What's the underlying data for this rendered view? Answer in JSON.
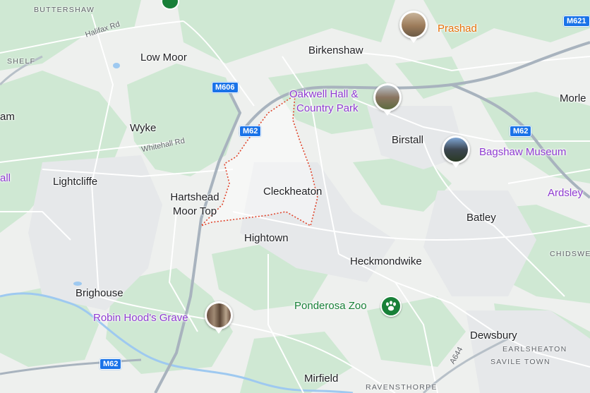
{
  "places": {
    "buttershaw": "BUTTERSHAW",
    "low_moor": "Low Moor",
    "shelf": "SHELF",
    "wyke": "Wyke",
    "lightcliffe": "Lightcliffe",
    "hartshead": "Hartshead Moor Top",
    "cleckheaton": "Cleckheaton",
    "hightown": "Hightown",
    "brighouse": "Brighouse",
    "birkenshaw": "Birkenshaw",
    "birstall": "Birstall",
    "batley": "Batley",
    "heckmondwike": "Heckmondwike",
    "dewsbury": "Dewsbury",
    "mirfield": "Mirfield",
    "morley": "Morle",
    "chidswell": "CHIDSWEL",
    "earlsheaton": "EARLSHEATON",
    "savile_town": "SAVILE TOWN",
    "ravensthorpe": "RAVENSTHORPE",
    "left_edge_m": "am",
    "left_edge_all": "all"
  },
  "pois": {
    "prashad": "Prashad",
    "oakwell_line1": "Oakwell Hall &",
    "oakwell_line2": "Country Park",
    "bagshaw": "Bagshaw Museum",
    "ardsley": "Ardsley",
    "ponderosa": "Ponderosa Zoo",
    "robin_hood": "Robin Hood's Grave"
  },
  "roads": {
    "halifax_rd": "Halifax Rd",
    "whitehall_rd": "Whitehall Rd",
    "a644": "A644",
    "shield_m606": "M606",
    "shield_m62_a": "M62",
    "shield_m62_b": "M62",
    "shield_m62_c": "M62",
    "shield_m621": "M621"
  },
  "colors": {
    "background": "#eef0ee",
    "green": "#cfe8d3",
    "road": "#ffffff",
    "motorway": "#a8b3be",
    "water": "#9ec9f0",
    "boundary": "#e0452c",
    "poi_purple": "#8f3bd1",
    "poi_orange": "#e8710a",
    "poi_green": "#188038",
    "shield": "#1a73e8"
  },
  "icons": {
    "zoo": "paw-icon",
    "place_photo": "photo-thumbnail"
  }
}
